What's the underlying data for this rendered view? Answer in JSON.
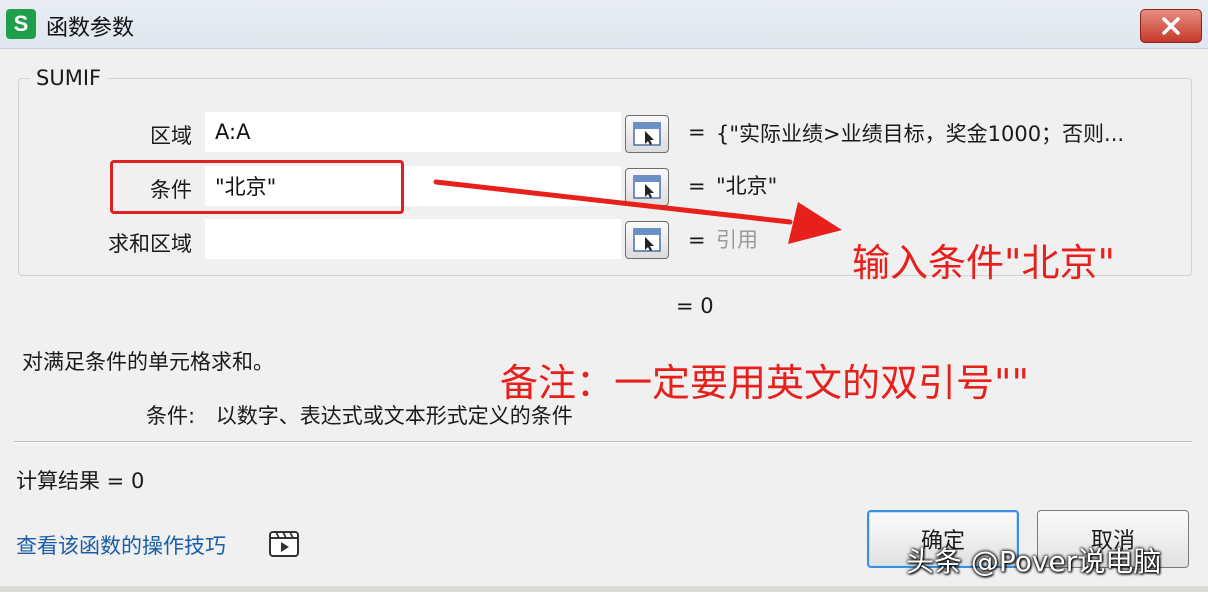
{
  "window": {
    "title": "函数参数",
    "app_icon_letter": "S"
  },
  "function": {
    "name": "SUMIF"
  },
  "args": [
    {
      "label": "区域",
      "input": "A:A",
      "value": "{\"实际业绩>业绩目标，奖金1000；否则..."
    },
    {
      "label": "条件",
      "input": "\"北京\"",
      "value": "\"北京\""
    },
    {
      "label": "求和区域",
      "input": "",
      "value": "引用"
    }
  ],
  "equals_sign": "=",
  "formula_result": "= 0",
  "description": "对满足条件的单元格求和。",
  "param_help": {
    "name": "条件:",
    "text": "以数字、表达式或文本形式定义的条件"
  },
  "calc_result": "计算结果 = 0",
  "help_link": "查看该函数的操作技巧",
  "buttons": {
    "ok": "确定",
    "cancel": "取消"
  },
  "annotations": {
    "input_hint": "输入条件\"北京\"",
    "note": "备注：一定要用英文的双引号\"\""
  },
  "watermark": "头条 @Pover说电脑",
  "colors": {
    "annotation": "#e8201c",
    "app_icon": "#1f9e4b",
    "link": "#1a5ea8",
    "close": "#c5382a"
  }
}
